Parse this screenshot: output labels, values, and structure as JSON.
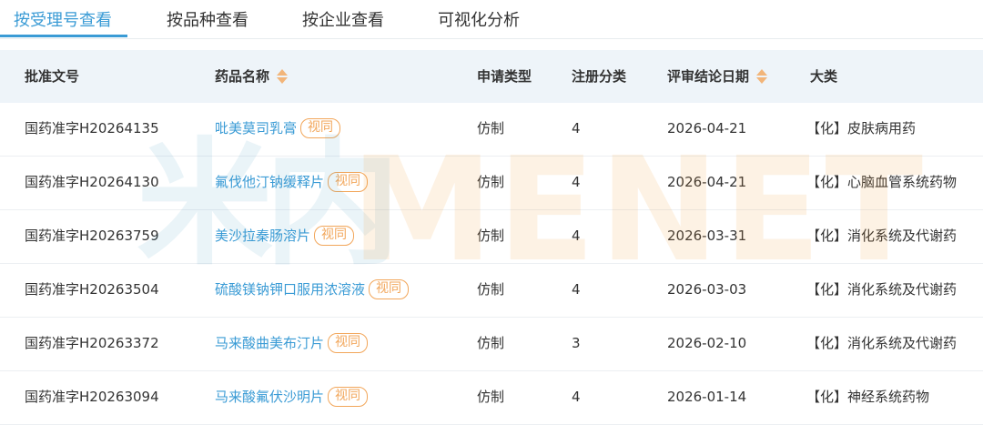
{
  "tabs": [
    {
      "label": "按受理号查看",
      "active": true
    },
    {
      "label": "按品种查看",
      "active": false
    },
    {
      "label": "按企业查看",
      "active": false
    },
    {
      "label": "可视化分析",
      "active": false
    }
  ],
  "watermark": {
    "cn": "米内",
    "en": "MENET"
  },
  "colors": {
    "accent": "#3a9bd5",
    "badge": "#f2a65a",
    "header_bg": "#eef4f9"
  },
  "table": {
    "headers": [
      "批准文号",
      "药品名称",
      "申请类型",
      "注册分类",
      "评审结论日期",
      "大类"
    ],
    "sortable_columns": [
      "药品名称",
      "评审结论日期"
    ],
    "rows": [
      {
        "approval_no": "国药准字H20264135",
        "drug": "吡美莫司乳膏",
        "badge": "视同",
        "app_type": "仿制",
        "reg_class": "4",
        "date": "2026-04-21",
        "category": "【化】皮肤病用药"
      },
      {
        "approval_no": "国药准字H20264130",
        "drug": "氟伐他汀钠缓释片",
        "badge": "视同",
        "app_type": "仿制",
        "reg_class": "4",
        "date": "2026-04-21",
        "category": "【化】心脑血管系统药物"
      },
      {
        "approval_no": "国药准字H20263759",
        "drug": "美沙拉秦肠溶片",
        "badge": "视同",
        "app_type": "仿制",
        "reg_class": "4",
        "date": "2026-03-31",
        "category": "【化】消化系统及代谢药"
      },
      {
        "approval_no": "国药准字H20263504",
        "drug": "硫酸镁钠钾口服用浓溶液",
        "badge": "视同",
        "app_type": "仿制",
        "reg_class": "4",
        "date": "2026-03-03",
        "category": "【化】消化系统及代谢药"
      },
      {
        "approval_no": "国药准字H20263372",
        "drug": "马来酸曲美布汀片",
        "badge": "视同",
        "app_type": "仿制",
        "reg_class": "3",
        "date": "2026-02-10",
        "category": "【化】消化系统及代谢药"
      },
      {
        "approval_no": "国药准字H20263094",
        "drug": "马来酸氟伏沙明片",
        "badge": "视同",
        "app_type": "仿制",
        "reg_class": "4",
        "date": "2026-01-14",
        "category": "【化】神经系统药物"
      }
    ]
  }
}
